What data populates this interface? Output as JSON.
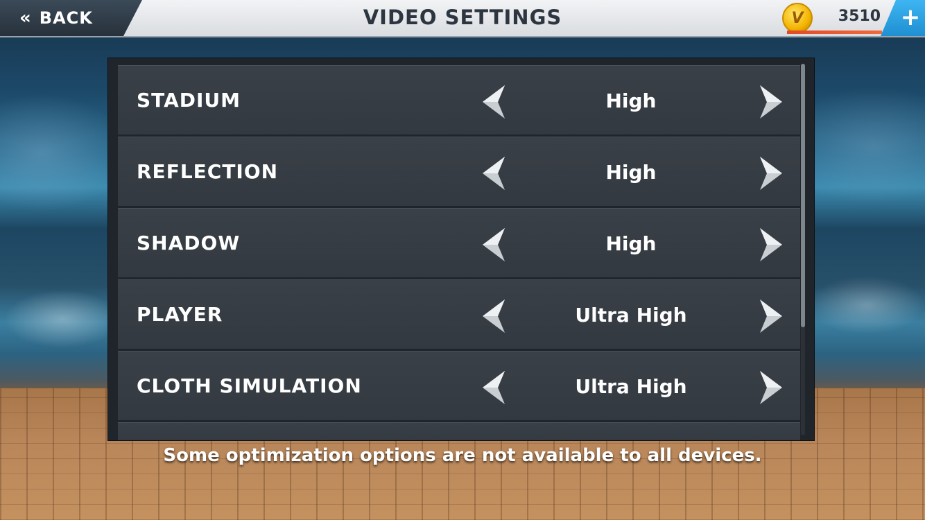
{
  "header": {
    "back_icon": "«",
    "back_label": "BACK",
    "title": "VIDEO SETTINGS",
    "coin_glyph": "V",
    "coin_count": "3510",
    "add_icon": "+"
  },
  "settings": [
    {
      "label": "STADIUM",
      "value": "High"
    },
    {
      "label": "REFLECTION",
      "value": "High"
    },
    {
      "label": "SHADOW",
      "value": "High"
    },
    {
      "label": "PLAYER",
      "value": "Ultra High"
    },
    {
      "label": "CLOTH SIMULATION",
      "value": "Ultra High"
    }
  ],
  "footnote": "Some optimization options are not available to all devices.",
  "colors": {
    "panel": "#1f252b",
    "row": "#363c43",
    "accent_blue": "#2fa3e3",
    "coin_gold": "#f3b400",
    "coin_bar": "#e04a2a"
  },
  "icons": {
    "back": "double-chevron-left-icon",
    "coin": "coin-icon",
    "add": "plus-icon",
    "decrease": "arrow-left-icon",
    "increase": "arrow-right-icon"
  }
}
